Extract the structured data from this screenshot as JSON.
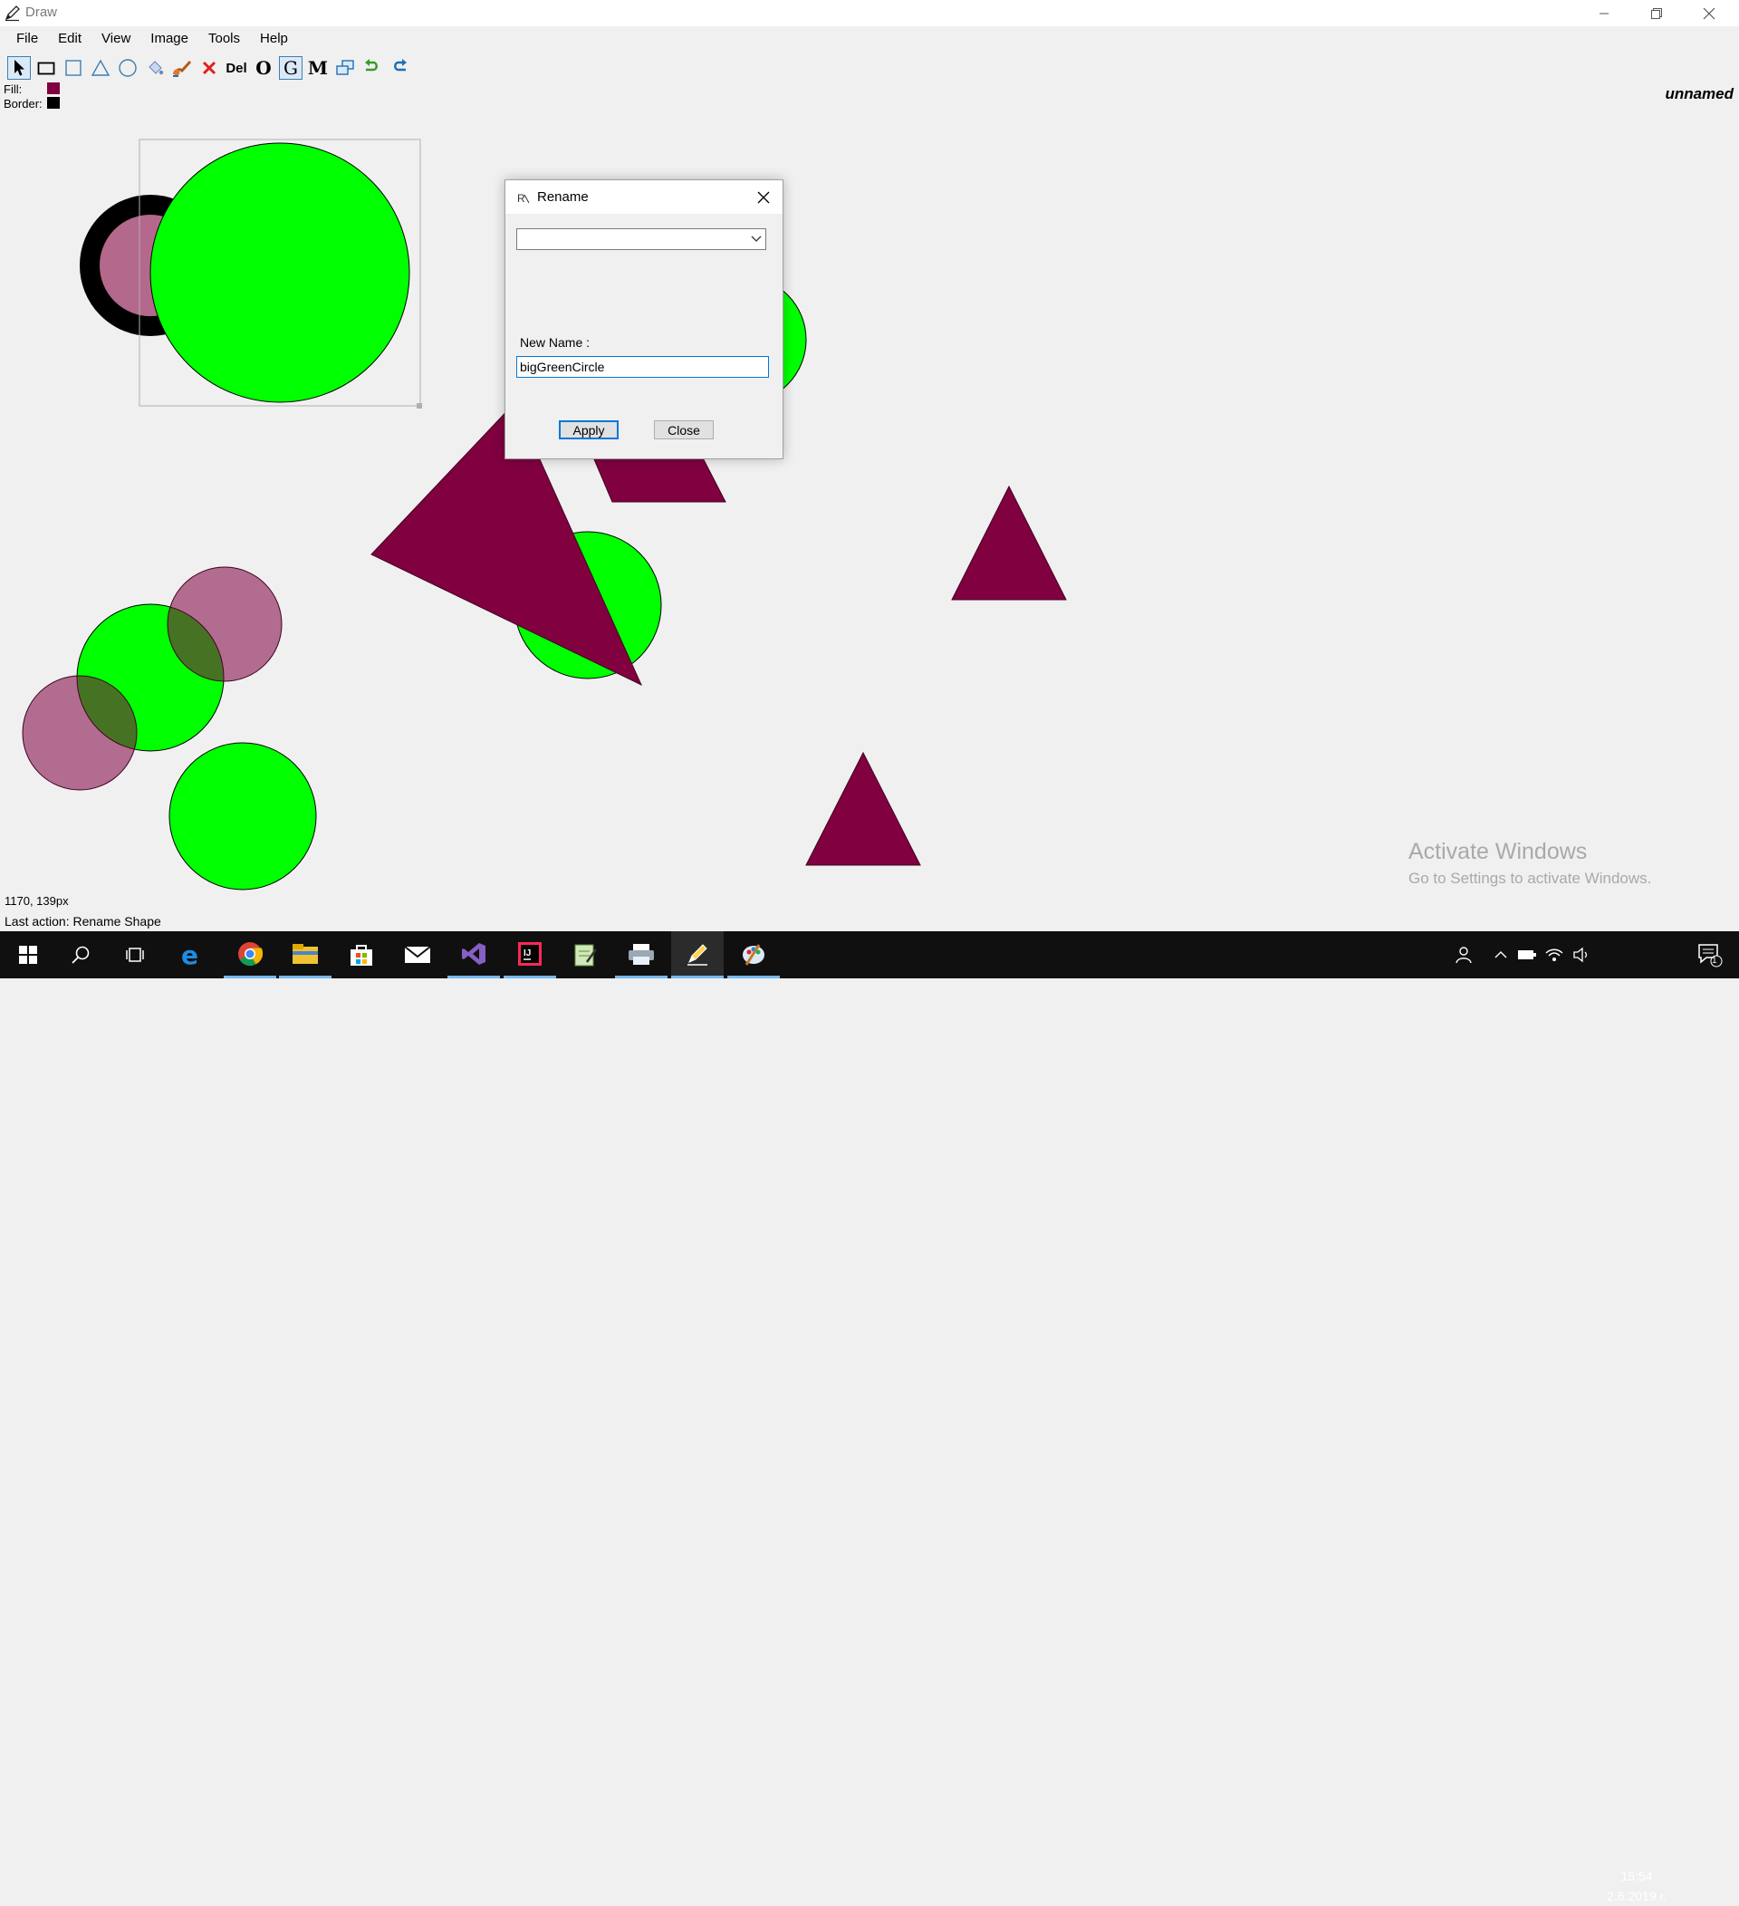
{
  "window": {
    "title": "Draw",
    "document_name": "unnamed",
    "icons": {
      "app": "pencil-icon",
      "minimize": "minimize-icon",
      "restore": "restore-icon",
      "close": "close-icon"
    }
  },
  "menu": [
    "File",
    "Edit",
    "View",
    "Image",
    "Tools",
    "Help"
  ],
  "toolbar": {
    "tools": [
      "select-arrow-icon",
      "rectangle-tool-icon",
      "square-tool-icon",
      "triangle-tool-icon",
      "ellipse-tool-icon",
      "fill-bucket-icon",
      "brush-icon",
      "delete-x-icon",
      "del-text-icon",
      "o-text-icon",
      "g-text-icon",
      "m-text-icon",
      "copy-icon",
      "undo-icon",
      "redo-icon"
    ],
    "del_label": "Del",
    "o_label": "O",
    "g_label": "G",
    "m_label": "M"
  },
  "properties": {
    "fill_label": "Fill:",
    "border_label": "Border:",
    "fill_color": "#800040",
    "border_color": "#000000"
  },
  "status": {
    "coords": "1170, 139px",
    "last_action": "Last action: Rename Shape"
  },
  "watermark": {
    "line1": "Activate Windows",
    "line2": "Go to Settings to activate Windows."
  },
  "dialog": {
    "title": "Rename",
    "dropdown_value": "",
    "new_name_label": "New Name :",
    "new_name_value": "bigGreenCircle",
    "apply_label": "Apply",
    "close_label": "Close"
  },
  "colors": {
    "green_shape": "#00ff00",
    "maroon_shape": "#800040",
    "pink_shape": "#b4688c",
    "taskbar": "#101010",
    "accent": "#0078d7"
  },
  "taskbar": {
    "apps": [
      "start-icon",
      "search-icon",
      "task-view-icon",
      "edge-icon",
      "chrome-icon",
      "file-explorer-icon",
      "store-icon",
      "mail-icon",
      "visual-studio-icon",
      "intellij-icon",
      "notepad-icon",
      "printer-icon",
      "draw-app-icon",
      "paint-icon"
    ],
    "time": "15:54",
    "date": "2.6.2019 г.",
    "notification_count": "1"
  }
}
